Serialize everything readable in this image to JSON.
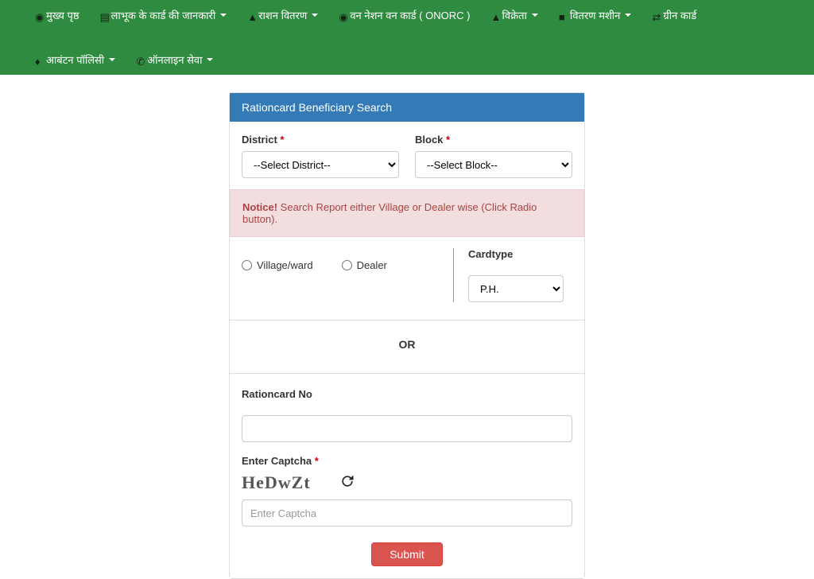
{
  "nav": {
    "items": [
      {
        "label": "मुख्य पृष्ठ",
        "icon": "circle",
        "caret": false
      },
      {
        "label": "लाभूक के कार्ड की जानकारी",
        "icon": "card",
        "caret": true
      },
      {
        "label": "राशन वितरण",
        "icon": "person",
        "caret": true
      },
      {
        "label": "वन नेशन वन कार्ड ( ONORC )",
        "icon": "circle",
        "caret": false
      },
      {
        "label": "विक्रेता",
        "icon": "person",
        "caret": true
      },
      {
        "label": "वितरण मशीन",
        "icon": "machine",
        "caret": true
      },
      {
        "label": "ग्रीन कार्ड",
        "icon": "swap",
        "caret": false
      },
      {
        "label": "आबंटन पॉलिसी",
        "icon": "drop",
        "caret": true
      },
      {
        "label": "ऑनलाइन सेवा",
        "icon": "phone",
        "caret": true
      }
    ]
  },
  "panel": {
    "heading": "Rationcard Beneficiary Search",
    "district_label": "District",
    "district_placeholder": "--Select District--",
    "block_label": "Block",
    "block_placeholder": "--Select Block--",
    "notice_strong": "Notice!",
    "notice_text": " Search Report either Village or Dealer wise (Click Radio button).",
    "radio_village": "Village/ward",
    "radio_dealer": "Dealer",
    "cardtype_label": "Cardtype",
    "cardtype_value": "P.H.",
    "or_text": "OR",
    "rationcard_label": "Rationcard No",
    "captcha_label": "Enter Captcha",
    "captcha_value": "HeDwZt",
    "captcha_placeholder": "Enter Captcha",
    "submit_label": "Submit"
  }
}
